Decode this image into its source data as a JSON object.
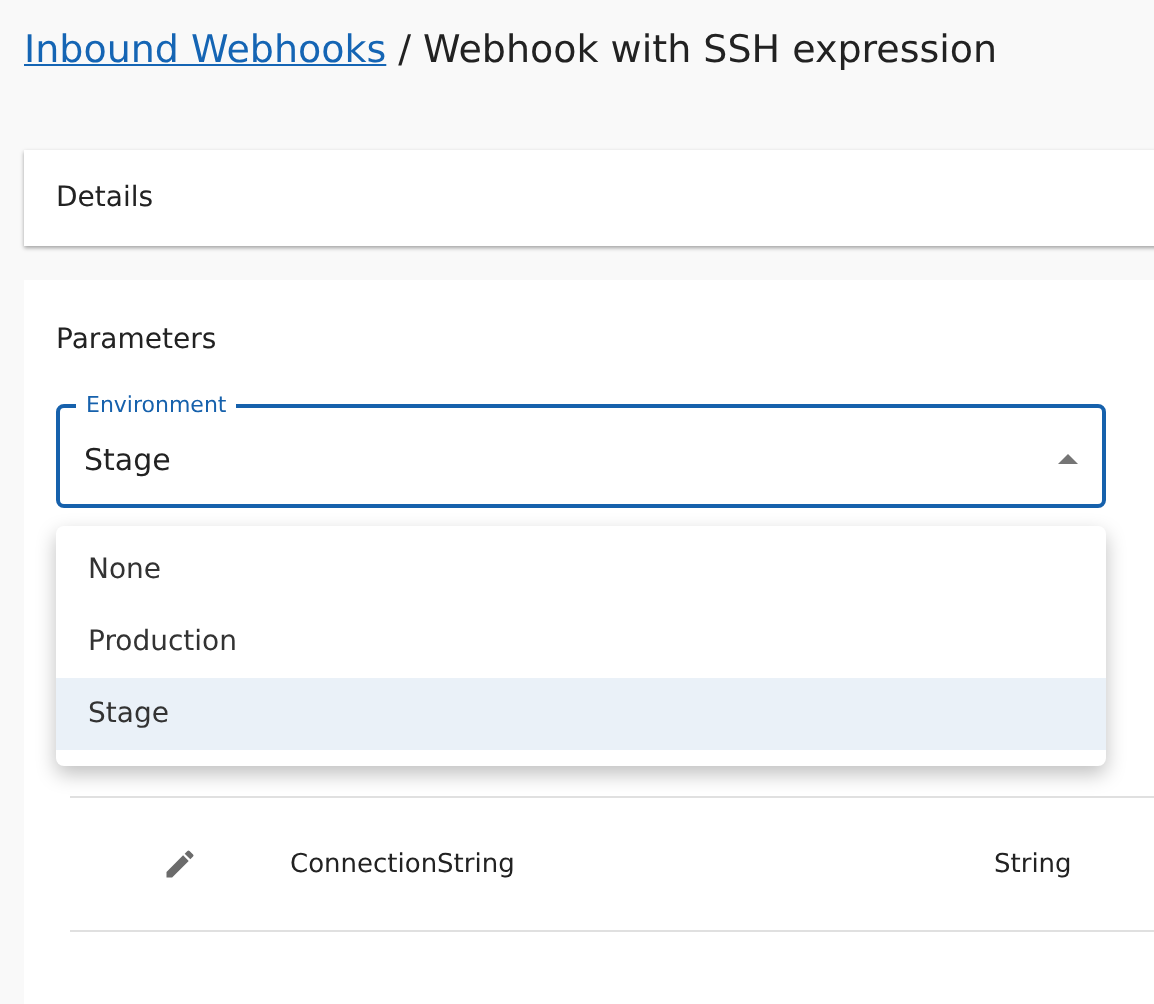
{
  "breadcrumb": {
    "link": "Inbound Webhooks",
    "separator": "/",
    "current": "Webhook with SSH expression"
  },
  "details": {
    "title": "Details"
  },
  "parameters": {
    "title": "Parameters",
    "environment": {
      "label": "Environment",
      "value": "Stage",
      "expanded": true,
      "options": [
        {
          "label": "None",
          "selected": false
        },
        {
          "label": "Production",
          "selected": false
        },
        {
          "label": "Stage",
          "selected": true
        }
      ]
    },
    "table": {
      "rows": [
        {
          "name": "ConnectionString",
          "data_type": "String"
        }
      ]
    }
  }
}
